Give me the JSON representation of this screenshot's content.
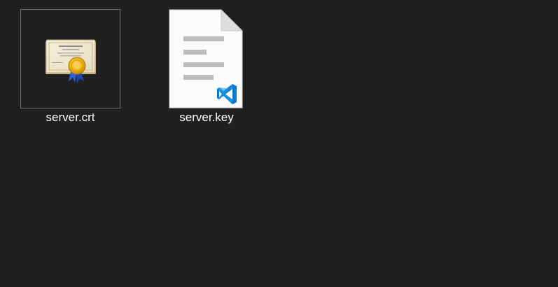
{
  "files": [
    {
      "name": "server.crt",
      "icon": "certificate-icon",
      "selected": true
    },
    {
      "name": "server.key",
      "icon": "vscode-document-icon",
      "selected": false
    }
  ],
  "colors": {
    "background": "#202020",
    "label_text": "#ffffff",
    "selection_border": "#6e6e6e",
    "vscode_blue": "#0a7ad4"
  }
}
